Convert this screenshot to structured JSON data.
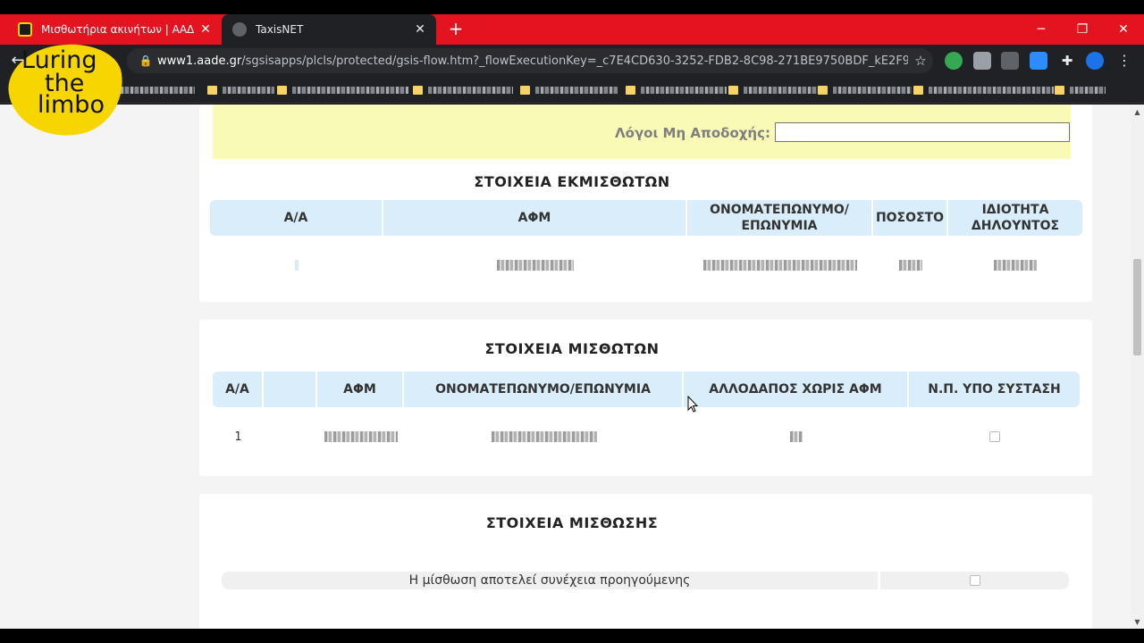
{
  "browser": {
    "tabs": [
      {
        "title": "Μισθωτήρια ακινήτων | ΑΑΔΕ",
        "active": false
      },
      {
        "title": "TaxisNET",
        "active": true
      }
    ],
    "url_host": "www1.aade.gr",
    "url_path": "/sgsisapps/plcls/protected/gsis-flow.htm?_flowExecutionKey=_c7E4CD630-3252-FDB2-8C98-271BE9750BDF_kE2F91AB...",
    "tabstrip_color": "#e3131f",
    "icons": [
      "back-icon",
      "lock-icon",
      "star-icon",
      "close-icon",
      "plus-icon",
      "minimize-icon",
      "restore-icon"
    ]
  },
  "overlay_logo": {
    "lines": [
      "Luring",
      "the",
      "limbo"
    ],
    "color": "#f7d600"
  },
  "page": {
    "reject_reasons": {
      "label": "Λόγοι Μη Αποδοχής:",
      "value": ""
    },
    "lessors": {
      "title": "ΣΤΟΙΧΕΙΑ ΕΚΜΙΣΘΩΤΩΝ",
      "columns": [
        "Α/Α",
        "ΑΦΜ",
        "ΟΝΟΜΑΤΕΠΩΝΥΜΟ/ ΕΠΩΝΥΜΙΑ",
        "ΠΟΣΟΣΤΟ",
        "ΙΔΙΟΤΗΤΑ ΔΗΛΟΥΝΤΟΣ"
      ]
    },
    "lessees": {
      "title": "ΣΤΟΙΧΕΙΑ ΜΙΣΘΩΤΩΝ",
      "columns": [
        "Α/Α",
        "",
        "ΑΦΜ",
        "ΟΝΟΜΑΤΕΠΩΝΥΜΟ/ΕΠΩΝΥΜΙΑ",
        "ΑΛΛΟΔΑΠΟΣ ΧΩΡΙΣ ΑΦΜ",
        "Ν.Π. ΥΠΟ ΣΥΣΤΑΣΗ"
      ],
      "rows": [
        {
          "aa": "1"
        }
      ]
    },
    "lease": {
      "title": "ΣΤΟΙΧΕΙΑ ΜΙΣΘΩΣΗΣ",
      "continuation_label": "Η μίσθωση αποτελεί συνέχεια προηγούμενης"
    },
    "header_color": "#d9edfb",
    "highlight_color": "#fafab7"
  }
}
